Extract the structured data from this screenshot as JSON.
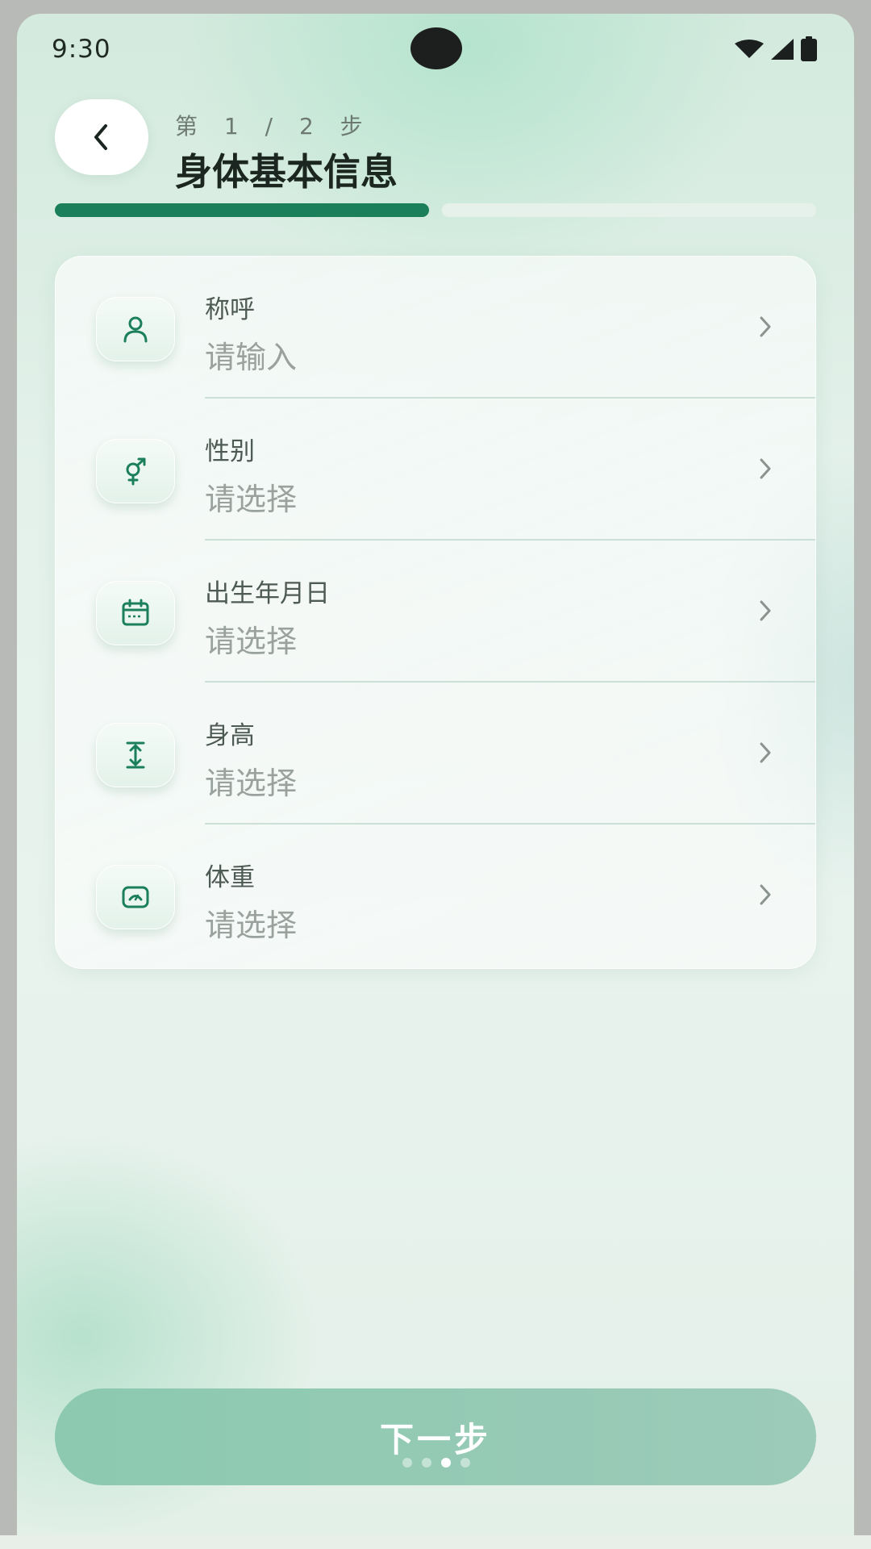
{
  "status_bar": {
    "time": "9:30",
    "icons": [
      "wifi-icon",
      "signal-icon",
      "battery-icon"
    ]
  },
  "header": {
    "back_icon": "chevron-left-icon",
    "step_label": "第 1 / 2 步",
    "title": "身体基本信息"
  },
  "progress": {
    "current_step": 1,
    "total_steps": 2,
    "colors": {
      "active": "#1a7f5a",
      "inactive": "#e7f1ec"
    }
  },
  "form": {
    "rows": [
      {
        "icon": "user-icon",
        "label": "称呼",
        "value": "请输入"
      },
      {
        "icon": "gender-icon",
        "label": "性别",
        "value": "请选择"
      },
      {
        "icon": "calendar-icon",
        "label": "出生年月日",
        "value": "请选择"
      },
      {
        "icon": "height-icon",
        "label": "身高",
        "value": "请选择"
      },
      {
        "icon": "scale-icon",
        "label": "体重",
        "value": "请选择"
      }
    ],
    "row_chevron_icon": "chevron-right-icon"
  },
  "footer": {
    "next_label": "下一步",
    "page_dots": {
      "count": 4,
      "active_index": 2
    }
  },
  "colors": {
    "accent": "#1a7f5a",
    "button": "#8fc8b2"
  }
}
